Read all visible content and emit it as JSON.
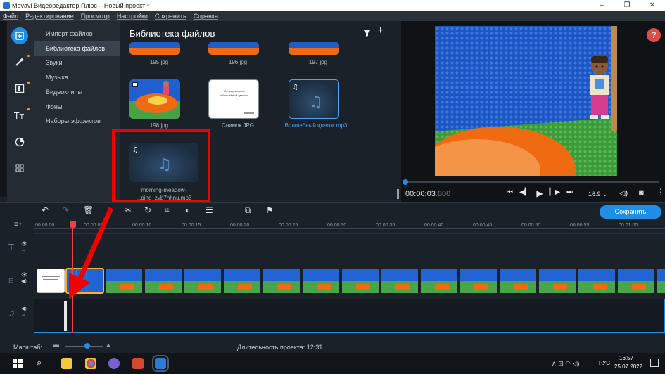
{
  "window": {
    "title": "Movavi Видеоредактор Плюс – Новый проект *",
    "min": "–",
    "max": "❐",
    "close": "✕"
  },
  "menu": [
    "Файл",
    "Редактирование",
    "Просмотр",
    "Настройки",
    "Сохранить",
    "Справка"
  ],
  "nav": {
    "items": [
      "Импорт файлов",
      "Библиотека файлов",
      "Звуки",
      "Музыка",
      "Видеоклипы",
      "Фоны",
      "Наборы эффектов"
    ],
    "active": 1
  },
  "library": {
    "title": "Библиотека файлов",
    "row0": [
      "195.jpg",
      "196.jpg",
      "197.jpg"
    ],
    "row1": [
      "198.jpg",
      "Снимок.JPG",
      "Волшебный цветок.mp3"
    ],
    "selected_caption_line1": "morning-meadow-",
    "selected_caption_line2": "...ping_zyb7nhnu.mp3",
    "doc_title": "Муниципальное",
    "doc_sub": "«Волшебный цветок»"
  },
  "preview": {
    "timecode": "00:00:03",
    "timecode_frac": ".800",
    "aspect": "16:9",
    "help": "?"
  },
  "timeline": {
    "export_label": "Сохранить",
    "ruler": [
      "00:00:00",
      "00:00:05",
      "00:00:10",
      "00:00:15",
      "00:00:20",
      "00:00:25",
      "00:00:30",
      "00:00:35",
      "00:00:40",
      "00:00:45",
      "00:00:50",
      "00:00:55",
      "00:01:00"
    ],
    "scale_label": "Масштаб:",
    "duration_label": "Длительность проекта: 12:31"
  },
  "taskbar": {
    "lang": "РУС",
    "time": "16:57",
    "date": "25.07.2022",
    "tray": "∧  ⊡  ◠  ◁)"
  },
  "colors": {
    "accent": "#1e8ee6",
    "annotation": "#f20000",
    "clip_yellow": "#ffb020"
  }
}
